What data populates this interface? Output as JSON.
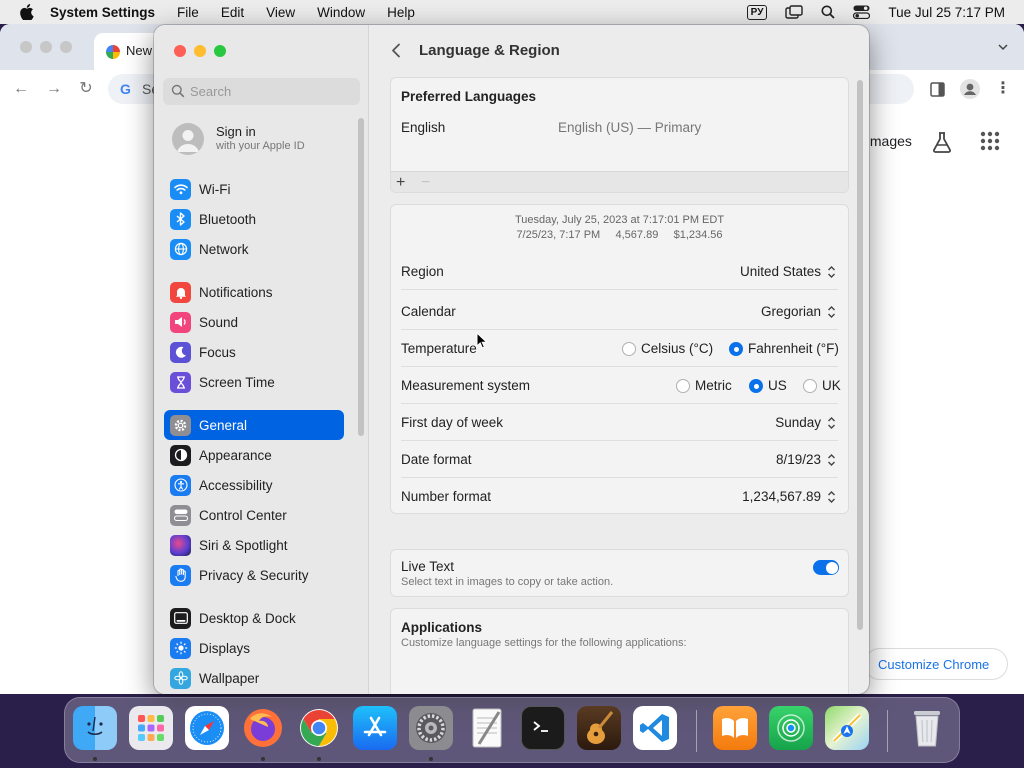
{
  "menubar": {
    "app_name": "System Settings",
    "items": [
      "File",
      "Edit",
      "View",
      "Window",
      "Help"
    ],
    "keyboard_layout": "РУ",
    "clock": "Tue Jul 25  7:17 PM"
  },
  "chrome": {
    "tab_title": "New",
    "omnibox_text": "Se",
    "images_link": "Images",
    "customize_button": "Customize Chrome"
  },
  "sidebar": {
    "search_placeholder": "Search",
    "signin_title": "Sign in",
    "signin_subtitle": "with your Apple ID",
    "items": [
      {
        "label": "Wi-Fi",
        "icon": "wifi-icon",
        "color": "#1a8cf5"
      },
      {
        "label": "Bluetooth",
        "icon": "bluetooth-icon",
        "color": "#1a8cf5"
      },
      {
        "label": "Network",
        "icon": "globe-icon",
        "color": "#1a8cf5"
      },
      {
        "label": "Notifications",
        "icon": "bell-icon",
        "color": "#f2473f"
      },
      {
        "label": "Sound",
        "icon": "speaker-icon",
        "color": "#f2457d"
      },
      {
        "label": "Focus",
        "icon": "moon-icon",
        "color": "#5b52d6"
      },
      {
        "label": "Screen Time",
        "icon": "hourglass-icon",
        "color": "#6a4fd8"
      },
      {
        "label": "General",
        "icon": "gear-icon",
        "color": "#8e8e93"
      },
      {
        "label": "Appearance",
        "icon": "appearance-icon",
        "color": "#1c1c1e"
      },
      {
        "label": "Accessibility",
        "icon": "accessibility-icon",
        "color": "#1a7cf0"
      },
      {
        "label": "Control Center",
        "icon": "control-center-icon",
        "color": "#8e8e93"
      },
      {
        "label": "Siri & Spotlight",
        "icon": "siri-icon",
        "color": "#3a3a9c"
      },
      {
        "label": "Privacy & Security",
        "icon": "hand-icon",
        "color": "#1a7cf0"
      },
      {
        "label": "Desktop & Dock",
        "icon": "dock-icon",
        "color": "#1c1c1e"
      },
      {
        "label": "Displays",
        "icon": "sun-icon",
        "color": "#1a7cf0"
      },
      {
        "label": "Wallpaper",
        "icon": "flower-icon",
        "color": "#35a7e0"
      }
    ],
    "active_item": "General"
  },
  "header": {
    "title": "Language & Region"
  },
  "preferred_languages": {
    "heading": "Preferred Languages",
    "language": "English",
    "language_detail": "English (US) — Primary",
    "add_label": "+",
    "remove_label": "−"
  },
  "region_settings": {
    "preview_line1": "Tuesday, July 25, 2023 at 7:17:01 PM EDT",
    "preview_line2": "7/25/23, 7:17 PM     4,567.89     $1,234.56",
    "region_label": "Region",
    "region_value": "United States",
    "calendar_label": "Calendar",
    "calendar_value": "Gregorian",
    "temperature_label": "Temperature",
    "temperature_options": [
      "Celsius (°C)",
      "Fahrenheit (°F)"
    ],
    "temperature_selected": "Fahrenheit (°F)",
    "measurement_label": "Measurement system",
    "measurement_options": [
      "Metric",
      "US",
      "UK"
    ],
    "measurement_selected": "US",
    "first_day_label": "First day of week",
    "first_day_value": "Sunday",
    "date_format_label": "Date format",
    "date_format_value": "8/19/23",
    "number_format_label": "Number format",
    "number_format_value": "1,234,567.89"
  },
  "live_text": {
    "title": "Live Text",
    "description": "Select text in images to copy or take action.",
    "enabled": true
  },
  "applications": {
    "heading": "Applications",
    "description": "Customize language settings for the following applications:",
    "add_label": "+",
    "remove_label": "−"
  },
  "dock": {
    "apps": [
      "Finder",
      "Launchpad",
      "Safari",
      "Firefox",
      "Chrome",
      "App Store",
      "System Settings",
      "TextEdit",
      "Terminal",
      "GarageBand",
      "Visual Studio Code",
      "Books",
      "Find My",
      "Maps",
      "Trash"
    ]
  },
  "colors": {
    "accent": "#0a71eb",
    "sidebar_selection": "#0063e1"
  }
}
